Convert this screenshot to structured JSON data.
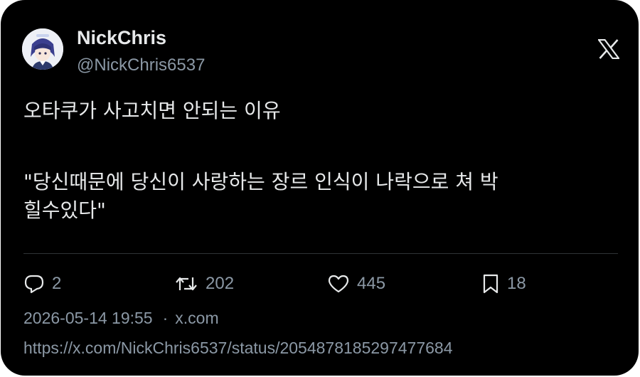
{
  "author": {
    "name": "NickChris",
    "handle": "@NickChris6537"
  },
  "brand": {
    "logo_icon": "x-logo-icon"
  },
  "tweet": {
    "line1": "오타쿠가 사고치면 안되는 이유",
    "line2": "\"당신때문에 당신이 사랑하는 장르 인식이 나락으로 쳐 박",
    "line3": "힐수있다\""
  },
  "actions": {
    "reply": {
      "icon": "reply-icon",
      "count": "2"
    },
    "retweet": {
      "icon": "retweet-icon",
      "count": "202"
    },
    "like": {
      "icon": "heart-icon",
      "count": "445"
    },
    "bookmark": {
      "icon": "bookmark-icon",
      "count": "18"
    }
  },
  "meta": {
    "timestamp": "2026-05-14 19:55",
    "separator": "·",
    "source": "x.com"
  },
  "status_url": "https://x.com/NickChris6537/status/2054878185297477684",
  "colors": {
    "background": "#000000",
    "text": "#e7e9ea",
    "muted": "#8b98a5",
    "divider": "#2f3336"
  }
}
